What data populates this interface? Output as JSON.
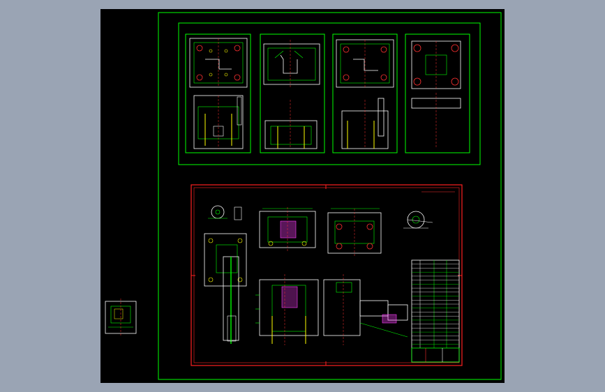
{
  "viewport": {
    "background": "#000000",
    "page_bg": "#9aa4b4"
  },
  "colors": {
    "frame_green": "#00ff00",
    "frame_red": "#ff2020",
    "detail_white": "#ffffff",
    "detail_yellow": "#ffff00",
    "detail_red": "#ff3030",
    "detail_cyan": "#00ffff",
    "detail_magenta": "#ff40ff"
  },
  "sheets": {
    "upper_count": 4,
    "table_rows": 22
  }
}
